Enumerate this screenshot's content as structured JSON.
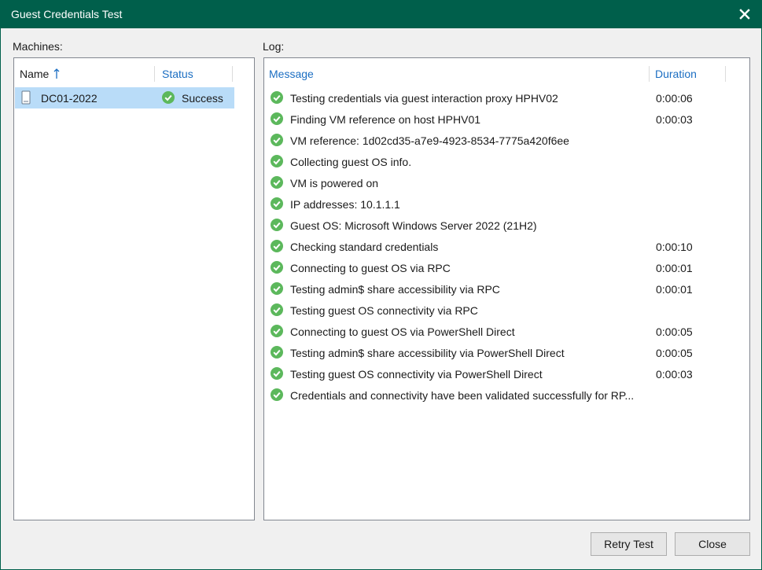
{
  "window": {
    "title": "Guest Credentials Test"
  },
  "machines": {
    "label": "Machines:",
    "columns": {
      "name": "Name",
      "status": "Status"
    },
    "rows": [
      {
        "name": "DC01-2022",
        "status": "Success"
      }
    ]
  },
  "log": {
    "label": "Log:",
    "columns": {
      "message": "Message",
      "duration": "Duration"
    },
    "rows": [
      {
        "message": "Testing credentials via guest interaction proxy HPHV02",
        "duration": "0:00:06"
      },
      {
        "message": "Finding VM reference on host HPHV01",
        "duration": "0:00:03"
      },
      {
        "message": "VM reference: 1d02cd35-a7e9-4923-8534-7775a420f6ee",
        "duration": ""
      },
      {
        "message": "Collecting guest OS info.",
        "duration": ""
      },
      {
        "message": "VM is powered on",
        "duration": ""
      },
      {
        "message": "IP addresses: 10.1.1.1",
        "duration": ""
      },
      {
        "message": "Guest OS: Microsoft Windows Server 2022 (21H2)",
        "duration": ""
      },
      {
        "message": "Checking standard credentials",
        "duration": "0:00:10"
      },
      {
        "message": "Connecting to guest OS via RPC",
        "duration": "0:00:01"
      },
      {
        "message": "Testing admin$ share accessibility via RPC",
        "duration": "0:00:01"
      },
      {
        "message": "Testing guest OS connectivity via RPC",
        "duration": ""
      },
      {
        "message": "Connecting to guest OS via PowerShell Direct",
        "duration": "0:00:05"
      },
      {
        "message": "Testing admin$ share accessibility via PowerShell Direct",
        "duration": "0:00:05"
      },
      {
        "message": "Testing guest OS connectivity via PowerShell Direct",
        "duration": "0:00:03"
      },
      {
        "message": "Credentials and connectivity have been validated successfully for RP...",
        "duration": ""
      }
    ]
  },
  "buttons": {
    "retry": "Retry Test",
    "close": "Close"
  },
  "colors": {
    "titlebar": "#005f4b",
    "success": "#5cb85c",
    "selection": "#b9dcf8",
    "header_blue": "#1b6ec2"
  },
  "icons": {
    "status": "check-circle-icon",
    "machine": "server-icon",
    "close": "close-icon",
    "sort": "sort-ascending-icon"
  }
}
